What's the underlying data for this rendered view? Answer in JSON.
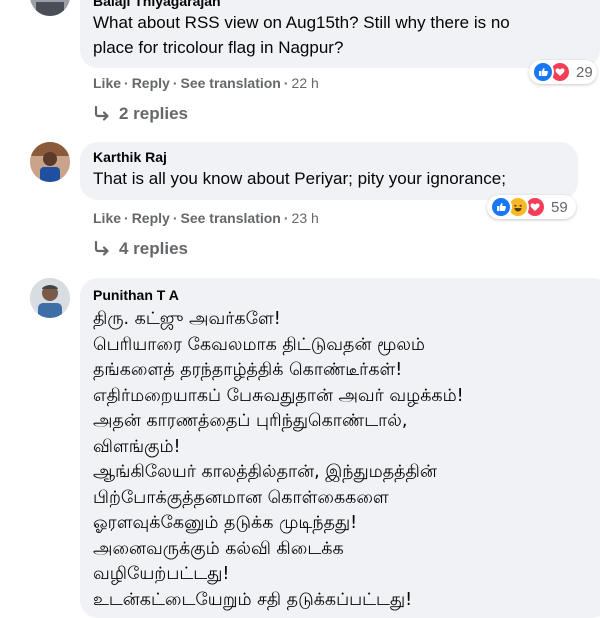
{
  "comments": [
    {
      "author": "Balaji Thiyagarajan",
      "text_lines": [
        "What about RSS view on Aug15th? Still why there is no",
        "place for tricolour flag in Nagpur?"
      ],
      "actions": {
        "like": "Like",
        "reply": "Reply",
        "translate": "See translation",
        "time": "22 h"
      },
      "reaction_count": "29",
      "reaction_icons": [
        "like-reaction",
        "love-reaction"
      ],
      "replies_label": "2 replies"
    },
    {
      "author": "Karthik Raj",
      "text_lines": [
        "That is all you know about Periyar; pity your ignorance;"
      ],
      "actions": {
        "like": "Like",
        "reply": "Reply",
        "translate": "See translation",
        "time": "23 h"
      },
      "reaction_count": "59",
      "reaction_icons": [
        "like-reaction",
        "haha-reaction",
        "love-reaction"
      ],
      "replies_label": "4 replies"
    },
    {
      "author": "Punithan T A",
      "text_lines": [
        "திரு. கட்ஜு அவர்களே!",
        "பெரியாரை கேவலமாக திட்டுவதன் மூலம்",
        "தங்களைத் தரந்தாழ்த்திக் கொண்டீர்கள்!",
        "எதிர்மறையாகப் பேசுவதுதான் அவர் வழக்கம்!",
        "அதன் காரணத்தைப் புரிந்துகொண்டால்,",
        "விளங்கும்!",
        "ஆங்கிலேயர் காலத்தில்தான், இந்துமதத்தின்",
        "பிற்போக்குத்தனமான கொள்கைகளை",
        "ஓரளவுக்கேனும் தடுக்க முடிந்தது!",
        "அனைவருக்கும் கல்வி கிடைக்க",
        "வழியேற்பட்டது!",
        "உடன்கட்டையேறும் சதி தடுக்கப்பட்டது!"
      ]
    }
  ],
  "colors": {
    "bubble": "#f0f2f5",
    "meta_text": "#65676b",
    "like_blue": "#1877f2",
    "love_red": "#f33e58",
    "haha_yellow": "#f7b928"
  }
}
